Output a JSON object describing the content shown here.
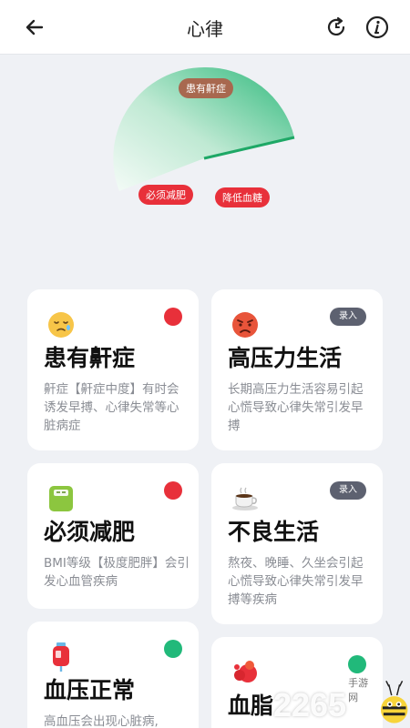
{
  "header": {
    "title": "心律",
    "back_icon": "arrow-left-icon",
    "refresh_icon": "refresh-icon",
    "info_icon": "info-icon"
  },
  "chart": {
    "labels": {
      "top": "患有鼾症",
      "left": "必须减肥",
      "right": "降低血糖"
    },
    "colors": {
      "sector_light": "#dff5ea",
      "sector_dark": "#29b678"
    }
  },
  "cards": [
    {
      "emoji": "sleepy-face-icon",
      "title": "患有鼾症",
      "desc": "鼾症【鼾症中度】有时会诱发早搏、心律失常等心脏病症",
      "status": "red"
    },
    {
      "emoji": "angry-face-icon",
      "title": "高压力生活",
      "desc": "长期高压力生活容易引起心慌导致心律失常引发早搏",
      "badge": "录入"
    },
    {
      "emoji": "scale-icon",
      "title": "必须减肥",
      "desc": "BMI等级【极度肥胖】会引发心血管疾病",
      "status": "red"
    },
    {
      "emoji": "coffee-icon",
      "title": "不良生活",
      "desc": "熬夜、晚睡、久坐会引起心慌导致心律失常引发早搏等疾病",
      "badge": "录入"
    },
    {
      "emoji": "blood-bag-icon",
      "title": "血压正常",
      "desc": "高血压会出现心脏病,",
      "status": "green"
    },
    {
      "emoji": "lipid-icon",
      "title": "血脂",
      "desc": "",
      "status": "green"
    }
  ],
  "watermark": {
    "number": "2265",
    "site": "手游网"
  }
}
